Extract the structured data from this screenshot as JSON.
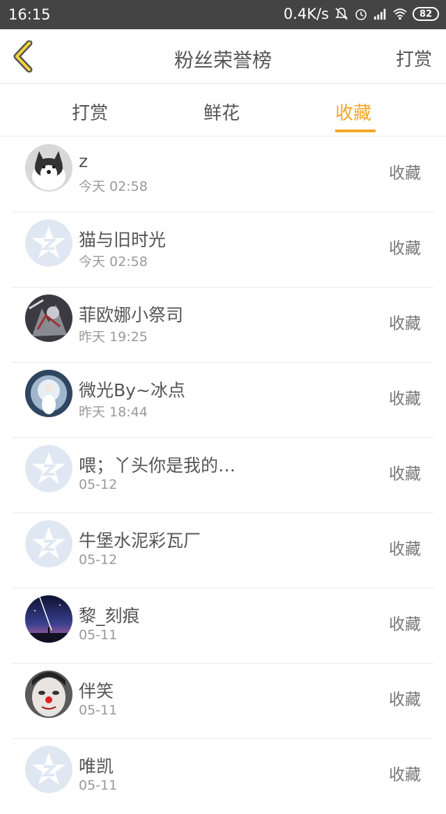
{
  "status_bar": {
    "time": "16:15",
    "network_speed": "0.4K/s",
    "battery": "82",
    "icons": [
      "mute-bell-icon",
      "alarm-icon",
      "signal-icon",
      "wifi-icon",
      "battery-icon"
    ]
  },
  "header": {
    "title": "粉丝荣誉榜",
    "action_label": "打赏"
  },
  "tabs": [
    {
      "label": "打赏",
      "active": false
    },
    {
      "label": "鲜花",
      "active": false
    },
    {
      "label": "收藏",
      "active": true
    }
  ],
  "colors": {
    "accent": "#f5a623",
    "status_bar_bg": "#444444",
    "text": "#555555",
    "subtext": "#999999"
  },
  "fans": [
    {
      "name": "z",
      "time": "今天 02:58",
      "action": "收藏",
      "avatar": "husky"
    },
    {
      "name": "猫与旧时光",
      "time": "今天 02:58",
      "action": "收藏",
      "avatar": "default"
    },
    {
      "name": "菲欧娜小祭司",
      "time": "昨天 19:25",
      "action": "收藏",
      "avatar": "anime-dark"
    },
    {
      "name": "微光By~冰点",
      "time": "昨天 18:44",
      "action": "收藏",
      "avatar": "anime-light"
    },
    {
      "name": "喂；丫头你是我的…",
      "time": "05-12",
      "action": "收藏",
      "avatar": "default"
    },
    {
      "name": "牛堡水泥彩瓦厂",
      "time": "05-12",
      "action": "收藏",
      "avatar": "default"
    },
    {
      "name": "黎_刻痕",
      "time": "05-11",
      "action": "收藏",
      "avatar": "night-sky"
    },
    {
      "name": "伴笑",
      "time": "05-11",
      "action": "收藏",
      "avatar": "clown"
    },
    {
      "name": "唯凯",
      "time": "05-11",
      "action": "收藏",
      "avatar": "default"
    }
  ]
}
